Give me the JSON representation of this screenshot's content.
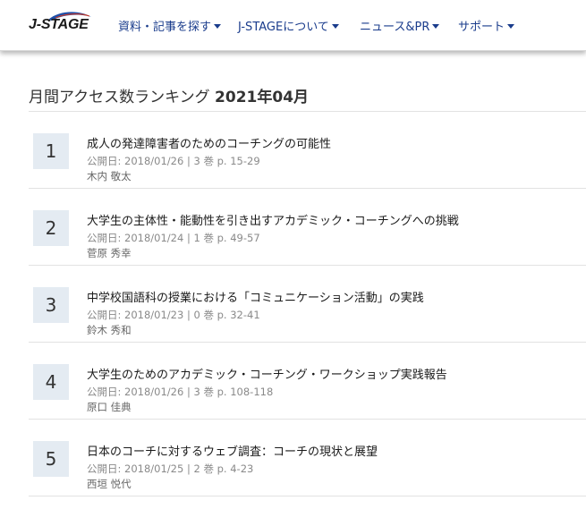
{
  "header": {
    "logo_text": "J-STAGE",
    "nav": [
      {
        "label": "資料・記事を探す"
      },
      {
        "label": "J-STAGEについて"
      },
      {
        "label": "ニュース&PR"
      },
      {
        "label": "サポート"
      }
    ]
  },
  "page": {
    "title_prefix": "月間アクセス数ランキング",
    "title_period": "2021年04月"
  },
  "ranking": [
    {
      "rank": "1",
      "title": "成人の発達障害者のためのコーチングの可能性",
      "meta": "公開日: 2018/01/26 | 3 巻 p. 15-29",
      "author": "木内 敬太"
    },
    {
      "rank": "2",
      "title": "大学生の主体性・能動性を引き出すアカデミック・コーチングへの挑戦",
      "meta": "公開日: 2018/01/24 | 1 巻 p. 49-57",
      "author": "菅原 秀幸"
    },
    {
      "rank": "3",
      "title": "中学校国語科の授業における「コミュニケーション活動」の実践",
      "meta": "公開日: 2018/01/23 | 0 巻 p. 32-41",
      "author": "鈴木 秀和"
    },
    {
      "rank": "4",
      "title": "大学生のためのアカデミック・コーチング・ワークショップ実践報告",
      "meta": "公開日: 2018/01/26 | 3 巻 p. 108-118",
      "author": "原口 佳典"
    },
    {
      "rank": "5",
      "title": "日本のコーチに対するウェブ調査：コーチの現状と展望",
      "meta": "公開日: 2018/01/25 | 2 巻 p. 4-23",
      "author": "西垣 悦代"
    }
  ],
  "colors": {
    "nav_link": "#1a3c8c",
    "rank_badge_bg": "#e4ebf2",
    "logo_swoosh": "#1f4fa8"
  }
}
